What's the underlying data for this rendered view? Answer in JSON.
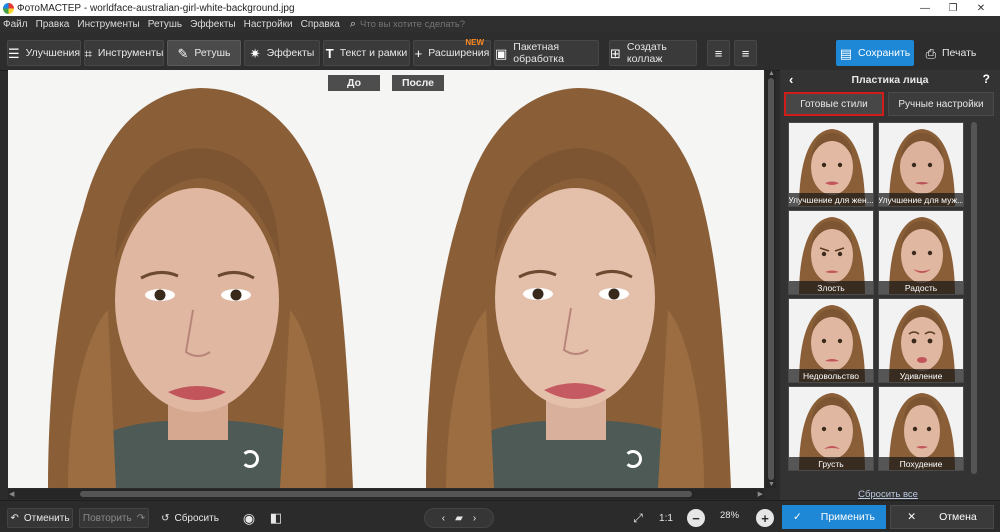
{
  "window": {
    "title": "ФотоМАСТЕР - worldface-australian-girl-white-background.jpg",
    "controls": {
      "minimize": "—",
      "maximize": "❐",
      "close": "✕"
    }
  },
  "menu": {
    "items": [
      "Файл",
      "Правка",
      "Инструменты",
      "Ретушь",
      "Эффекты",
      "Настройки",
      "Справка"
    ],
    "search_placeholder": "Что вы хотите сделать?"
  },
  "toolbar": {
    "tabs": [
      {
        "label": "Улучшения",
        "icon": "sliders-icon"
      },
      {
        "label": "Инструменты",
        "icon": "crop-icon"
      },
      {
        "label": "Ретушь",
        "icon": "brush-icon",
        "active": true
      },
      {
        "label": "Эффекты",
        "icon": "sparkle-icon"
      },
      {
        "label": "Текст и рамки",
        "icon": "text-icon"
      },
      {
        "label": "Расширения",
        "icon": "plus-icon",
        "badge": "NEW"
      },
      {
        "label": "Пакетная обработка",
        "icon": "images-icon"
      },
      {
        "label": "Создать коллаж",
        "icon": "collage-icon"
      }
    ],
    "save_label": "Сохранить",
    "print_label": "Печать"
  },
  "canvas": {
    "before_label": "До",
    "after_label": "После"
  },
  "panel": {
    "title": "Пластика лица",
    "tabs": [
      "Готовые стили",
      "Ручные настройки"
    ],
    "selected_tab": "Готовые стили",
    "presets": [
      "Улучшение для жен...",
      "Улучшение для муж...",
      "Злость",
      "Радость",
      "Недовольство",
      "Удивление",
      "Грусть",
      "Похудение"
    ],
    "reset_all_label": "Сбросить все"
  },
  "bottom": {
    "undo_label": "Отменить",
    "redo_label": "Повторить",
    "reset_label": "Сбросить",
    "zoom_ratio_label": "1:1",
    "zoom_percent": "28%",
    "apply_label": "Применить",
    "cancel_label": "Отмена"
  },
  "colors": {
    "accent": "#1e88d6",
    "selected_outline": "#d11c1c",
    "new_badge": "#ff8a1f"
  }
}
